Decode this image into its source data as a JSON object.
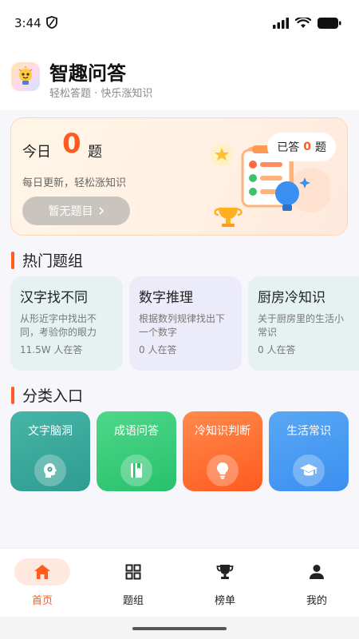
{
  "status_bar": {
    "time": "3:44",
    "icons": [
      "shield-icon",
      "signal-icon",
      "wifi-icon",
      "battery-icon"
    ]
  },
  "app": {
    "title": "智趣问答",
    "subtitle": "轻松答题 · 快乐涨知识",
    "logo_icon": "bulb-mascot-icon"
  },
  "today": {
    "label": "今日",
    "count": "0",
    "unit": "题",
    "description": "每日更新，轻松涨知识",
    "button_label": "暂无题目",
    "answered_prefix": "已答",
    "answered_count": "0",
    "answered_unit": "题"
  },
  "hot_section": {
    "title": "热门题组",
    "cards": [
      {
        "title": "汉字找不同",
        "desc_line1": "从形近字中找出不",
        "desc_line2": "同，考验你的眼力",
        "count": "11.5W 人在答",
        "color": "#e6f1f1"
      },
      {
        "title": "数字推理",
        "desc_line1": "根据数列规律找出下",
        "desc_line2": "一个数字",
        "count": "0 人在答",
        "color": "#ecebf9"
      },
      {
        "title": "厨房冷知识",
        "desc_line1": "关于厨房里的生活小",
        "desc_line2": "常识",
        "count": "0 人在答",
        "color": "#e6f1f1"
      }
    ]
  },
  "category_section": {
    "title": "分类入口",
    "items": [
      {
        "label": "文字脑洞",
        "icon": "head-gear-icon",
        "color_from": "#46b5a6",
        "color_to": "#2e9c92"
      },
      {
        "label": "成语问答",
        "icon": "book-icon",
        "color_from": "#4fd78a",
        "color_to": "#27c16c"
      },
      {
        "label": "冷知识判断",
        "icon": "lightbulb-icon",
        "color_from": "#ff8a4c",
        "color_to": "#ff5a1f"
      },
      {
        "label": "生活常识",
        "icon": "graduation-cap-icon",
        "color_from": "#59a8f5",
        "color_to": "#3b8ff0"
      }
    ]
  },
  "tabs": [
    {
      "label": "首页",
      "icon": "home-icon",
      "active": true
    },
    {
      "label": "题组",
      "icon": "grid-icon",
      "active": false
    },
    {
      "label": "榜单",
      "icon": "trophy-icon",
      "active": false
    },
    {
      "label": "我的",
      "icon": "user-icon",
      "active": false
    }
  ],
  "colors": {
    "accent": "#ff5a1f",
    "background": "#f7f7fb"
  }
}
